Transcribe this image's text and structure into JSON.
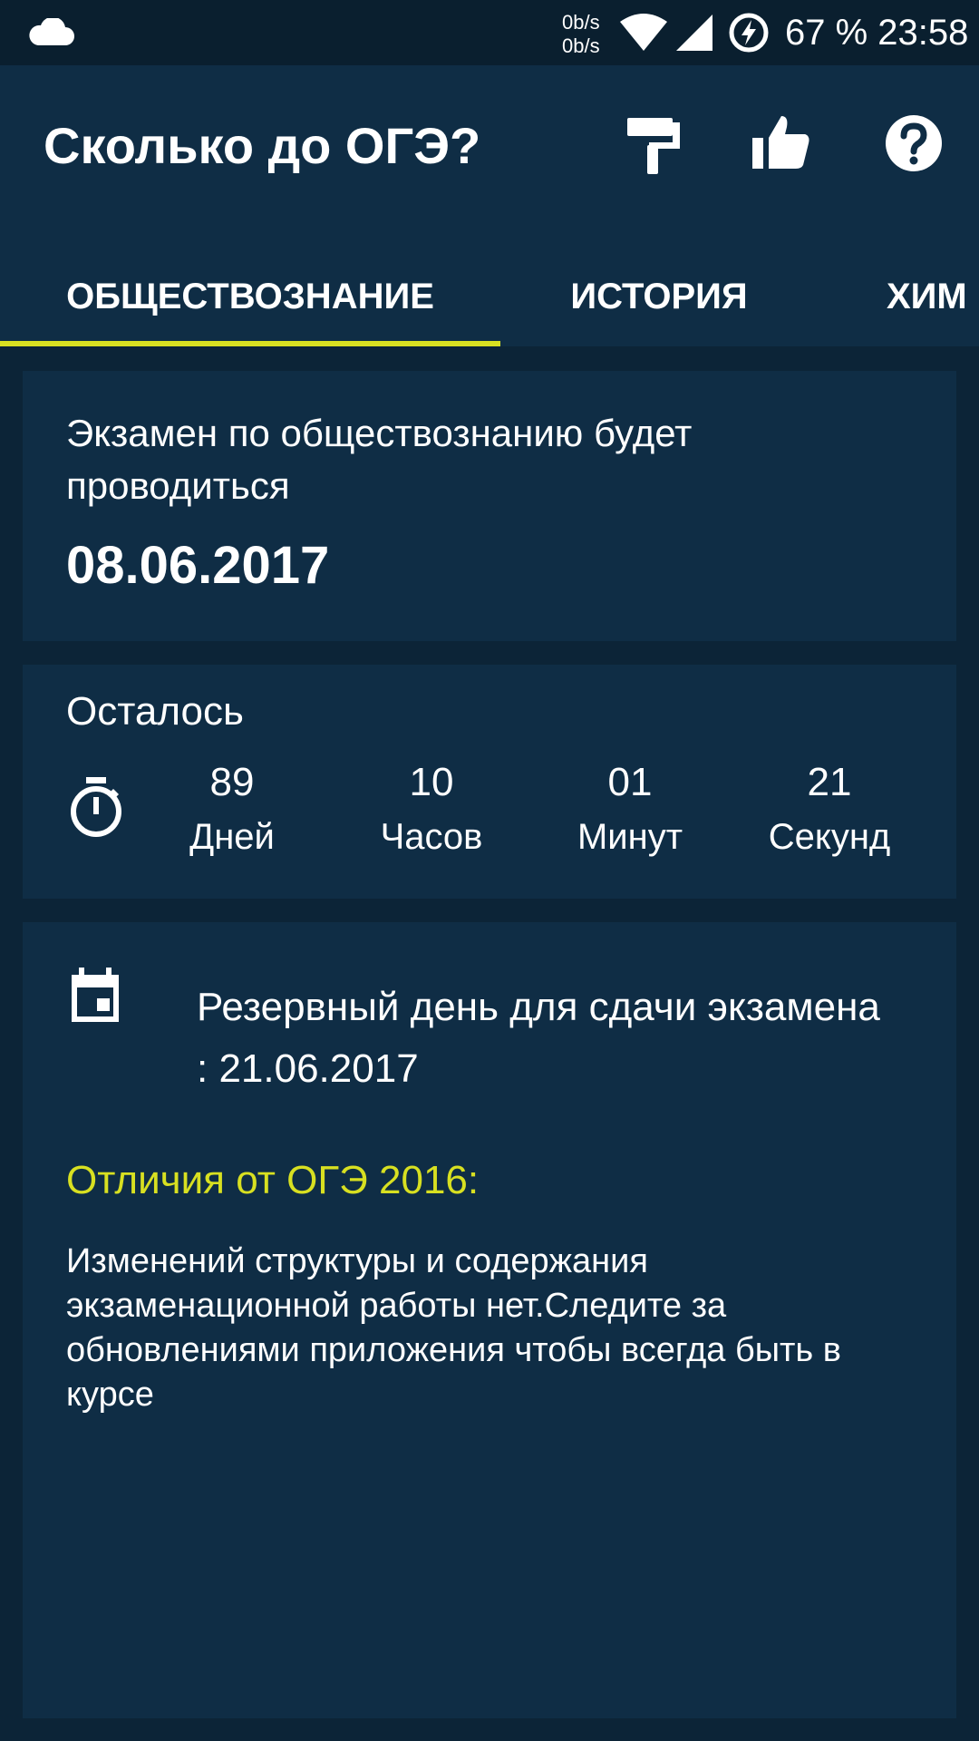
{
  "status_bar": {
    "net_up": "0b/s",
    "net_down": "0b/s",
    "battery": "67 %",
    "time": "23:58",
    "icons": [
      "cloud-icon",
      "wifi-icon",
      "signal-icon",
      "battery-charging-icon"
    ]
  },
  "app_bar": {
    "title": "Сколько до ОГЭ?",
    "icons": [
      "paint-roller-icon",
      "thumbs-up-icon",
      "help-icon"
    ]
  },
  "tabs": [
    {
      "label": "ОБЩЕСТВОЗНАНИЕ",
      "selected": true
    },
    {
      "label": "ИСТОРИЯ",
      "selected": false
    },
    {
      "label": "ХИМ",
      "selected": false
    }
  ],
  "exam_card": {
    "text": "Экзамен по обществознанию будет проводиться",
    "date": "08.06.2017"
  },
  "countdown": {
    "label": "Осталось",
    "items": [
      {
        "value": "89",
        "unit": "Дней"
      },
      {
        "value": "10",
        "unit": "Часов"
      },
      {
        "value": "01",
        "unit": "Минут"
      },
      {
        "value": "21",
        "unit": "Секунд"
      }
    ]
  },
  "info_card": {
    "reserve_text": "Резервный день для сдачи экзамена : 21.06.2017",
    "diff_title": "Отличия от ОГЭ 2016:",
    "diff_body": "Изменений структуры и содержания экзаменационной работы нет.Следите за обновлениями приложения чтобы всегда быть в курсе"
  },
  "colors": {
    "accent": "#d8e021",
    "app_bar": "#0f2d45",
    "status_bar": "#0a1f2f",
    "background": "#0c2437",
    "card": "#0f2d45"
  }
}
